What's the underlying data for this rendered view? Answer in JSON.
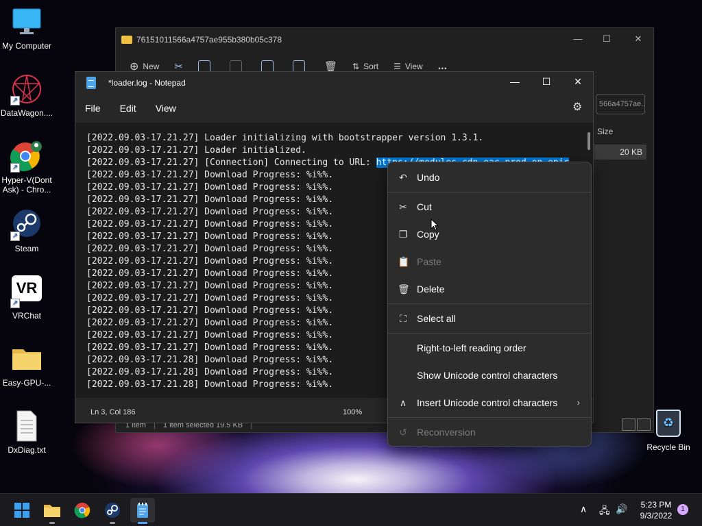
{
  "desktop": {
    "icons": [
      {
        "label": "My Computer"
      },
      {
        "label": "DataWagon...."
      },
      {
        "label": "Hyper-V(Dont Ask) - Chro..."
      },
      {
        "label": "Steam"
      },
      {
        "label": "VRChat"
      },
      {
        "label": "Easy-GPU-..."
      },
      {
        "label": "DxDiag.txt"
      }
    ],
    "vr_badge": "VR",
    "recycle_bin": "Recycle Bin"
  },
  "explorer": {
    "title": "76151011566a4757ae955b380b05c378",
    "toolbar": {
      "new": "New",
      "sort": "Sort",
      "view": "View",
      "more": "..."
    },
    "search_text": "566a4757ae...",
    "size_header": "Size",
    "size_value": "20 KB",
    "status": {
      "items": "1 item",
      "selected": "1 item selected  19.5 KB"
    }
  },
  "notepad": {
    "title": "*loader.log - Notepad",
    "menu": {
      "file": "File",
      "edit": "Edit",
      "view": "View"
    },
    "lines": [
      "[2022.09.03-17.21.27] Loader initializing with bootstrapper version 1.3.1.",
      "[2022.09.03-17.21.27] Loader initialized.",
      "[2022.09.03-17.21.27] [Connection] Connecting to URL: ",
      "[2022.09.03-17.21.27] Download Progress: %i%%.",
      "[2022.09.03-17.21.27] Download Progress: %i%%.",
      "[2022.09.03-17.21.27] Download Progress: %i%%.",
      "[2022.09.03-17.21.27] Download Progress: %i%%.",
      "[2022.09.03-17.21.27] Download Progress: %i%%.",
      "[2022.09.03-17.21.27] Download Progress: %i%%.",
      "[2022.09.03-17.21.27] Download Progress: %i%%.",
      "[2022.09.03-17.21.27] Download Progress: %i%%.",
      "[2022.09.03-17.21.27] Download Progress: %i%%.",
      "[2022.09.03-17.21.27] Download Progress: %i%%.",
      "[2022.09.03-17.21.27] Download Progress: %i%%.",
      "[2022.09.03-17.21.27] Download Progress: %i%%.",
      "[2022.09.03-17.21.27] Download Progress: %i%%.",
      "[2022.09.03-17.21.27] Download Progress: %i%%.",
      "[2022.09.03-17.21.27] Download Progress: %i%%.",
      "[2022.09.03-17.21.28] Download Progress: %i%%.",
      "[2022.09.03-17.21.28] Download Progress: %i%%.",
      "[2022.09.03-17.21.28] Download Progress: %i%%."
    ],
    "selected_url": "https://modules-cdn.eac-prod.on.epic",
    "status": {
      "position": "Ln 3, Col 186",
      "zoom": "100%"
    }
  },
  "context_menu": {
    "items": [
      {
        "label": "Undo",
        "icon": "undo-icon",
        "enabled": true
      },
      {
        "label": "Cut",
        "icon": "scissors-icon",
        "enabled": true
      },
      {
        "label": "Copy",
        "icon": "copy-icon",
        "enabled": true
      },
      {
        "label": "Paste",
        "icon": "paste-icon",
        "enabled": false
      },
      {
        "label": "Delete",
        "icon": "trash-icon",
        "enabled": true
      },
      {
        "label": "Select all",
        "icon": "select-all-icon",
        "enabled": true
      },
      {
        "label": "Right-to-left reading order",
        "enabled": true
      },
      {
        "label": "Show Unicode control characters",
        "enabled": true
      },
      {
        "label": "Insert Unicode control characters",
        "icon": "caret-up-icon",
        "enabled": true,
        "submenu": true
      },
      {
        "label": "Reconversion",
        "icon": "reconversion-icon",
        "enabled": false
      }
    ]
  },
  "taskbar": {
    "clock_time": "5:23 PM",
    "clock_date": "9/3/2022",
    "notification_count": "1"
  },
  "colors": {
    "selection": "#0078d4",
    "accent": "#5aa0ff",
    "notification": "#d6a8ff"
  }
}
